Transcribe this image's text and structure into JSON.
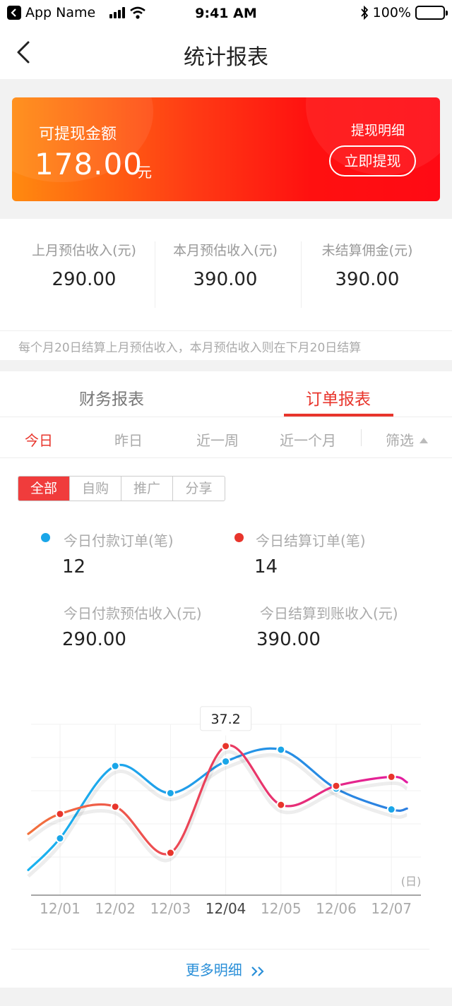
{
  "status_bar": {
    "app_name": "App Name",
    "time": "9:41 AM",
    "battery": "100%"
  },
  "nav": {
    "title": "统计报表"
  },
  "banner": {
    "label": "可提现金额",
    "amount": "178.00",
    "unit": "元",
    "detail_link": "提现明细",
    "withdraw_button": "立即提现",
    "colors": {
      "start": "#ff8a10",
      "end": "#ff0a14"
    }
  },
  "stats": {
    "items": [
      {
        "label": "上月预估收入(元)",
        "value": "290.00"
      },
      {
        "label": "本月预估收入(元)",
        "value": "390.00"
      },
      {
        "label": "未结算佣金(元)",
        "value": "390.00"
      }
    ],
    "note": "每个月20日结算上月预估收入，本月预估收入则在下月20日结算"
  },
  "report": {
    "tabs": [
      "财务报表",
      "订单报表"
    ],
    "active_tab": "订单报表",
    "periods": [
      "今日",
      "昨日",
      "近一周",
      "近一个月"
    ],
    "active_period": "今日",
    "filter": "筛选",
    "segments": [
      "全部",
      "自购",
      "推广",
      "分享"
    ],
    "active_segment": "全部",
    "metrics": [
      {
        "label": "今日付款订单(笔)",
        "value": "12"
      },
      {
        "label": "今日结算订单(笔)",
        "value": "14"
      },
      {
        "label": "今日付款预估收入(元)",
        "value": "290.00"
      },
      {
        "label": "今日结算到账收入(元)",
        "value": "390.00"
      }
    ],
    "more_link": "更多明细",
    "accent_color": "#e8352c",
    "link_color": "#2a8fd8"
  },
  "chart_data": {
    "type": "line",
    "categories": [
      "12/01",
      "12/02",
      "12/03",
      "12/04",
      "12/05",
      "12/06",
      "12/07"
    ],
    "x_unit_label": "(日)",
    "highlight_category": "12/04",
    "tooltip": "37.2",
    "grid": true,
    "series": [
      {
        "color": "#1aa6e8",
        "values": [
          27,
          35,
          32,
          35.5,
          36.8,
          32.5,
          30.2
        ]
      },
      {
        "color": "#e8352c",
        "values": [
          29.7,
          30.5,
          25.4,
          37.2,
          30.7,
          32.8,
          33.8
        ]
      }
    ]
  }
}
